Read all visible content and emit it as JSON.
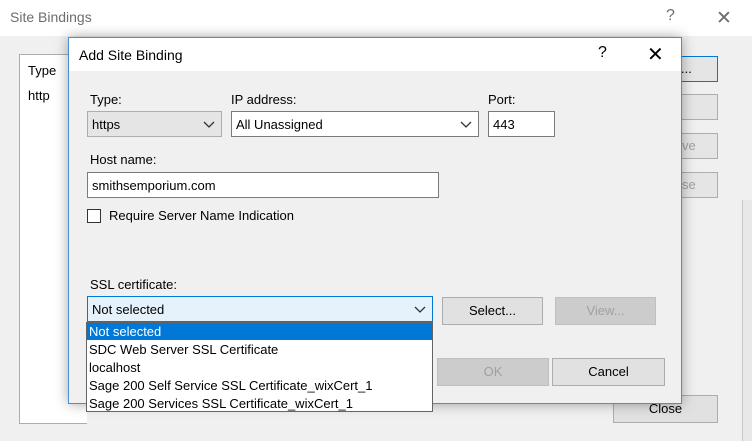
{
  "background_dialog": {
    "title": "Site Bindings",
    "help_glyph": "?",
    "close_glyph": "✕",
    "list": {
      "header": "Type",
      "rows": [
        "http"
      ]
    },
    "side_buttons": [
      "...",
      "",
      "ve",
      "se"
    ],
    "close_button": "Close"
  },
  "dialog": {
    "title": "Add Site Binding",
    "help_glyph": "?",
    "close_glyph": "✕",
    "type": {
      "label": "Type:",
      "value": "https"
    },
    "ip": {
      "label": "IP address:",
      "value": "All Unassigned"
    },
    "port": {
      "label": "Port:",
      "value": "443"
    },
    "host": {
      "label": "Host name:",
      "value": "smithsemporium.com"
    },
    "sni": {
      "label": "Require Server Name Indication",
      "checked": false
    },
    "ssl": {
      "label": "SSL certificate:",
      "value": "Not selected",
      "options": [
        "Not selected",
        "SDC Web Server SSL Certificate",
        "localhost",
        "Sage 200 Self Service SSL Certificate_wixCert_1",
        "Sage 200 Services SSL Certificate_wixCert_1"
      ],
      "highlighted_index": 0
    },
    "buttons": {
      "select": "Select...",
      "view": "View...",
      "ok": "OK",
      "cancel": "Cancel"
    }
  },
  "icons": {
    "dropdown_arrow": "chevron-down-icon",
    "close": "close-icon",
    "help": "help-icon"
  },
  "colors": {
    "accent": "#0078d7",
    "dialog_bg": "#f0f0f0",
    "selection_bg": "#0078d7"
  }
}
